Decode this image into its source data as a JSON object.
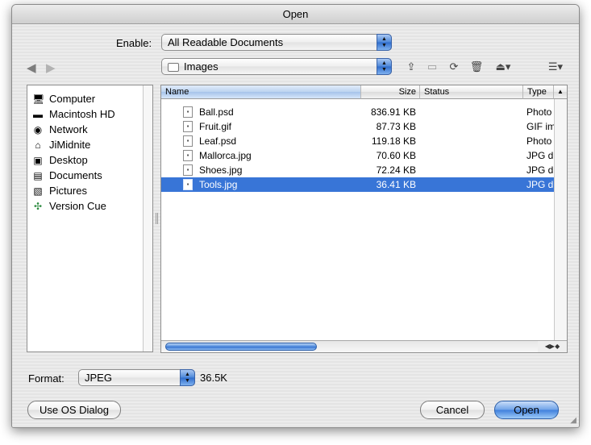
{
  "window": {
    "title": "Open"
  },
  "enable": {
    "label": "Enable:",
    "value": "All Readable Documents"
  },
  "location": {
    "value": "Images"
  },
  "sidebar": {
    "items": [
      {
        "label": "Computer",
        "icon": "computer-icon"
      },
      {
        "label": "Macintosh HD",
        "icon": "hard-drive-icon"
      },
      {
        "label": "Network",
        "icon": "network-globe-icon"
      },
      {
        "label": "JiMidnite",
        "icon": "user-home-icon"
      },
      {
        "label": "Desktop",
        "icon": "desktop-icon"
      },
      {
        "label": "Documents",
        "icon": "documents-folder-icon"
      },
      {
        "label": "Pictures",
        "icon": "pictures-folder-icon"
      },
      {
        "label": "Version Cue",
        "icon": "version-cue-icon"
      }
    ]
  },
  "filelist": {
    "columns": {
      "name": "Name",
      "size": "Size",
      "status": "Status",
      "type": "Type"
    },
    "rows": [
      {
        "name": "Ball.psd",
        "size": "836.91 KB",
        "status": "",
        "type": "Photo"
      },
      {
        "name": "Fruit.gif",
        "size": "87.73 KB",
        "status": "",
        "type": "GIF im"
      },
      {
        "name": "Leaf.psd",
        "size": "119.18 KB",
        "status": "",
        "type": "Photo"
      },
      {
        "name": "Mallorca.jpg",
        "size": "70.60 KB",
        "status": "",
        "type": "JPG d"
      },
      {
        "name": "Shoes.jpg",
        "size": "72.24 KB",
        "status": "",
        "type": "JPG d"
      },
      {
        "name": "Tools.jpg",
        "size": "36.41 KB",
        "status": "",
        "type": "JPG d",
        "selected": true
      }
    ]
  },
  "format": {
    "label": "Format:",
    "value": "JPEG",
    "file_size": "36.5K"
  },
  "buttons": {
    "os_dialog": "Use OS Dialog",
    "cancel": "Cancel",
    "open": "Open"
  },
  "colors": {
    "selection": "#3875d7",
    "default_button": "#3f7fdc"
  }
}
